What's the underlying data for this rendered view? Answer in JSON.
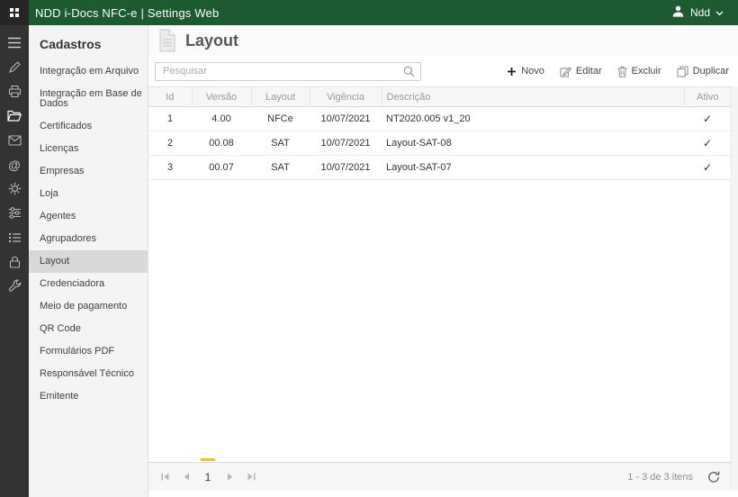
{
  "colors": {
    "topbar_green": "#1e5a2f",
    "iconbar_dark": "#333333",
    "selected_item_bg": "#d8d8d8",
    "page_indicator_amber": "#e9c42e"
  },
  "topbar": {
    "title": "NDD i-Docs NFC-e | Settings Web",
    "user_label": "Ndd"
  },
  "icons": {
    "at_glyph": "@"
  },
  "iconbar_items": [
    "menu",
    "pen",
    "printer",
    "folder-open",
    "mail",
    "at",
    "gear",
    "sliders",
    "list",
    "lock",
    "wrench"
  ],
  "sidebar": {
    "title": "Cadastros",
    "selected": "Layout",
    "items": [
      "Integração em Arquivo",
      "Integração em Base de Dados",
      "Certificados",
      "Licenças",
      "Empresas",
      "Loja",
      "Agentes",
      "Agrupadores",
      "Layout",
      "Credenciadora",
      "Meio de pagamento",
      "QR Code",
      "Formulários PDF",
      "Responsável Técnico",
      "Emitente"
    ]
  },
  "page": {
    "title": "Layout"
  },
  "search": {
    "placeholder": "Pesquisar"
  },
  "toolbar": {
    "novo": "Novo",
    "editar": "Editar",
    "excluir": "Excluir",
    "duplicar": "Duplicar"
  },
  "table": {
    "columns": [
      "Id",
      "Versão",
      "Layout",
      "Vigência",
      "Descrição",
      "Ativo"
    ],
    "rows": [
      {
        "id": "1",
        "versao": "4.00",
        "layout": "NFCe",
        "vigencia": "10/07/2021",
        "descricao": "NT2020.005 v1_20",
        "ativo": "✓"
      },
      {
        "id": "2",
        "versao": "00.08",
        "layout": "SAT",
        "vigencia": "10/07/2021",
        "descricao": "Layout-SAT-08",
        "ativo": "✓"
      },
      {
        "id": "3",
        "versao": "00.07",
        "layout": "SAT",
        "vigencia": "10/07/2021",
        "descricao": "Layout-SAT-07",
        "ativo": "✓"
      }
    ]
  },
  "pager": {
    "page": "1",
    "info": "1 - 3 de 3 itens"
  }
}
